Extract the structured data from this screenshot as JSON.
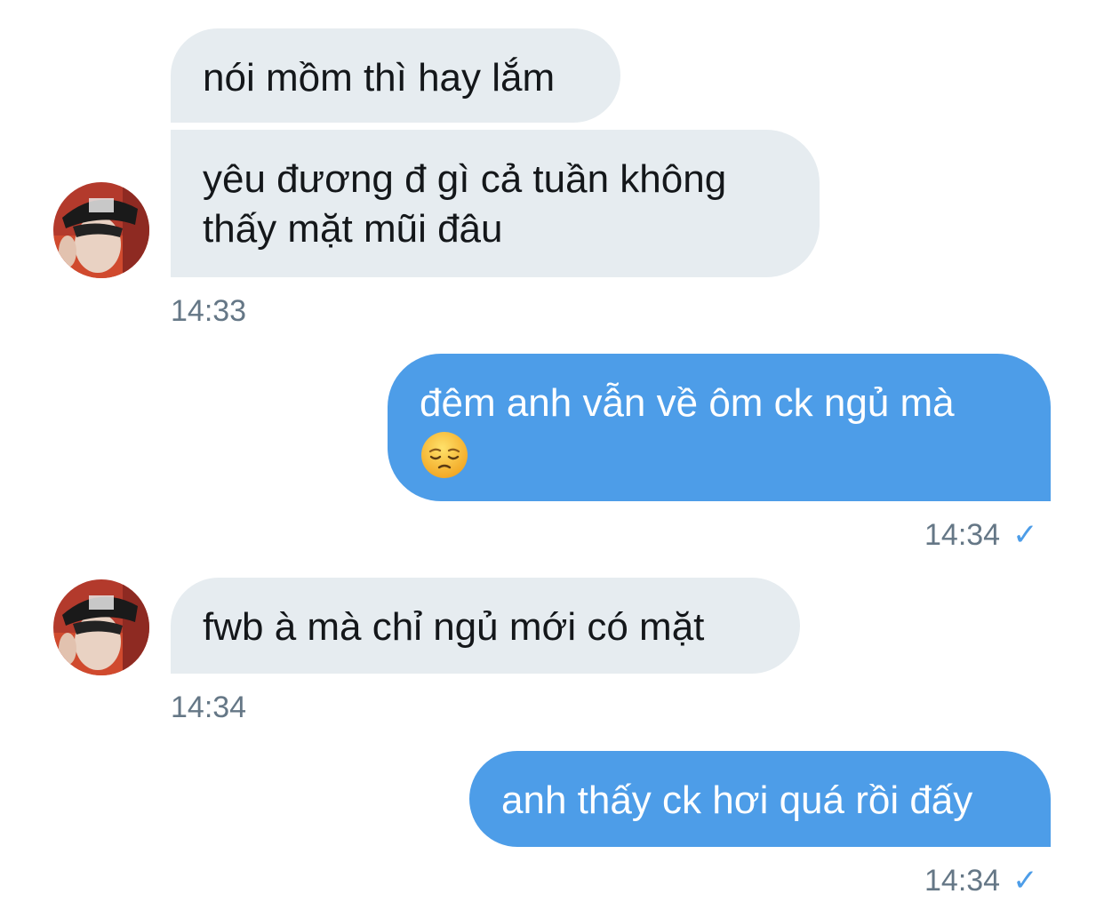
{
  "conversation": {
    "messages": [
      {
        "id": "m1",
        "direction": "incoming",
        "text": "nói mồm thì hay lắm"
      },
      {
        "id": "m2",
        "direction": "incoming",
        "text": "yêu đương đ gì cả tuần không thấy mặt mũi đâu",
        "time": "14:33"
      },
      {
        "id": "m3",
        "direction": "outgoing",
        "text": "đêm anh vẫn về ôm ck ngủ mà",
        "emoji": "pensive-face",
        "time": "14:34",
        "read": "✓"
      },
      {
        "id": "m4",
        "direction": "incoming",
        "text": "fwb à mà chỉ ngủ mới có mặt",
        "time": "14:34"
      },
      {
        "id": "m5",
        "direction": "outgoing",
        "text": "anh thấy ck hơi quá rồi đấy",
        "time": "14:34",
        "read": "✓"
      }
    ]
  },
  "colors": {
    "incoming_bubble": "#e6ecf0",
    "outgoing_bubble": "#4d9de8",
    "timestamp": "#657786",
    "read_check": "#4d9de8"
  }
}
